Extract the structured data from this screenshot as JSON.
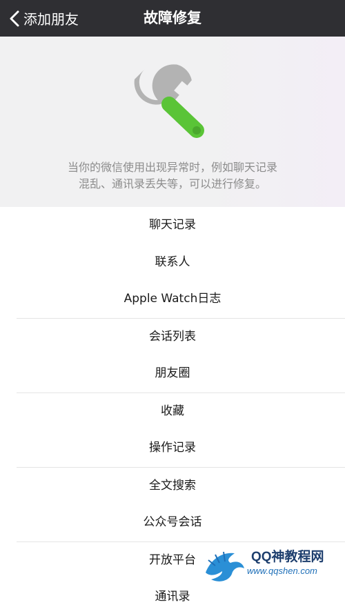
{
  "navbar": {
    "back_label": "添加朋友",
    "title": "故障修复",
    "back_icon": "chevron-left-icon"
  },
  "header": {
    "icon": "wrench-icon",
    "description_line1": "当你的微信使用出现异常时，例如聊天记录",
    "description_line2": "混乱、通讯录丢失等，可以进行修复。"
  },
  "list": {
    "groups": [
      [
        "聊天记录",
        "联系人",
        "Apple Watch日志"
      ],
      [
        "会话列表",
        "朋友圈"
      ],
      [
        "收藏",
        "操作记录"
      ],
      [
        "全文搜索",
        "公众号会话"
      ],
      [
        "开放平台",
        "通讯录"
      ]
    ]
  },
  "watermark": {
    "brand": "QQ神教程网",
    "url": "www.qqshen.com"
  },
  "colors": {
    "navbar_bg": "#2f2f33",
    "header_bg": "#f1f1f2",
    "wrench_grey": "#b3b3b3",
    "wrench_green": "#5ac437"
  }
}
